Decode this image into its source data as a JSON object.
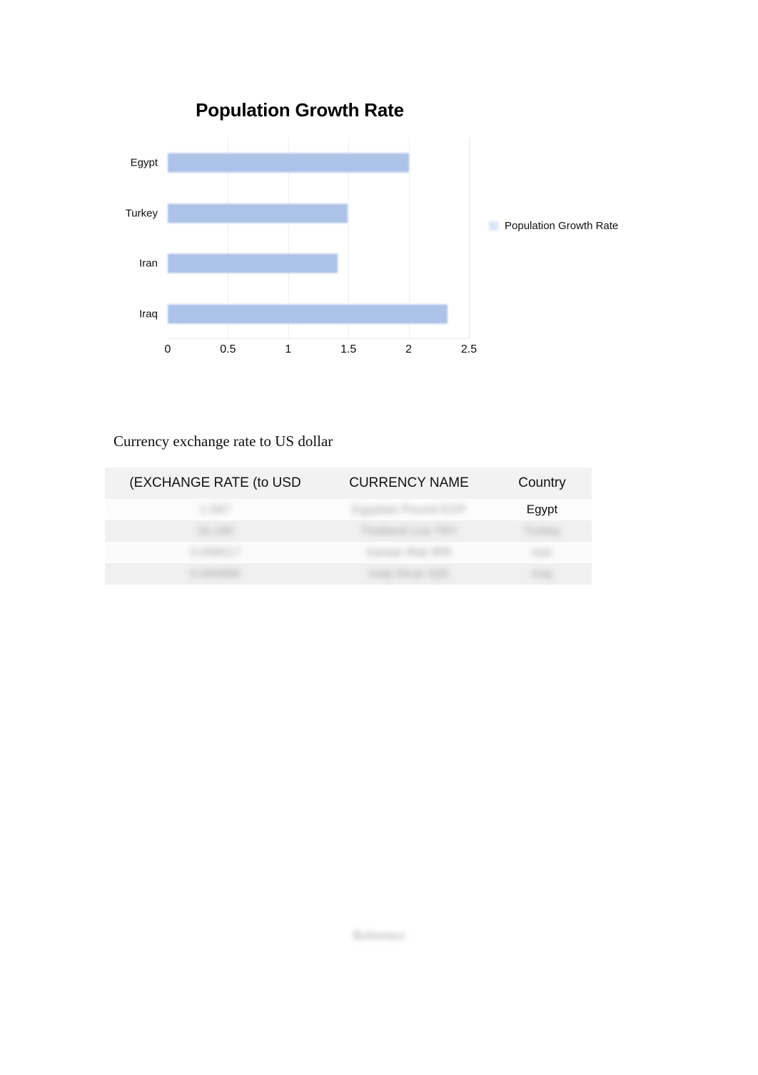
{
  "chart_data": {
    "type": "bar",
    "orientation": "horizontal",
    "title": "Population Growth Rate",
    "categories": [
      "Egypt",
      "Turkey",
      "Iran",
      "Iraq"
    ],
    "values": [
      2.0,
      1.49,
      1.41,
      2.32
    ],
    "series": [
      {
        "name": "Population Growth Rate",
        "values": [
          2.0,
          1.49,
          1.41,
          2.32
        ]
      }
    ],
    "xlabel": "",
    "ylabel": "",
    "xlim": [
      0,
      2.5
    ],
    "xticks": [
      0,
      0.5,
      1,
      1.5,
      2,
      2.5
    ],
    "xtick_labels": [
      "0",
      "0.5",
      "1",
      "1.5",
      "2",
      "2.5"
    ],
    "grid": true,
    "legend": {
      "position": "right",
      "entries": [
        "Population Growth Rate"
      ]
    },
    "bar_color": "#adc2e8"
  },
  "currency_section": {
    "caption": "Currency exchange rate to US dollar",
    "table": {
      "headers": [
        "(EXCHANGE RATE (to USD",
        "CURRENCY NAME",
        "Country"
      ],
      "rows": [
        {
          "rate": "1.587",
          "name": "Egyptian Pound EGP",
          "country": "Egypt",
          "redacted": true,
          "country_visible": true
        },
        {
          "rate": "19.180",
          "name": "Thailand Lira TRY",
          "country": "Turkey",
          "redacted": true,
          "country_visible": false
        },
        {
          "rate": "0.008017",
          "name": "Iranian Rial IRR",
          "country": "Iran",
          "redacted": true,
          "country_visible": false
        },
        {
          "rate": "0.000680",
          "name": "Iraqi Dinar IQD",
          "country": "Iraq",
          "redacted": true,
          "country_visible": false
        }
      ]
    }
  },
  "footer": {
    "text": "Reference"
  }
}
